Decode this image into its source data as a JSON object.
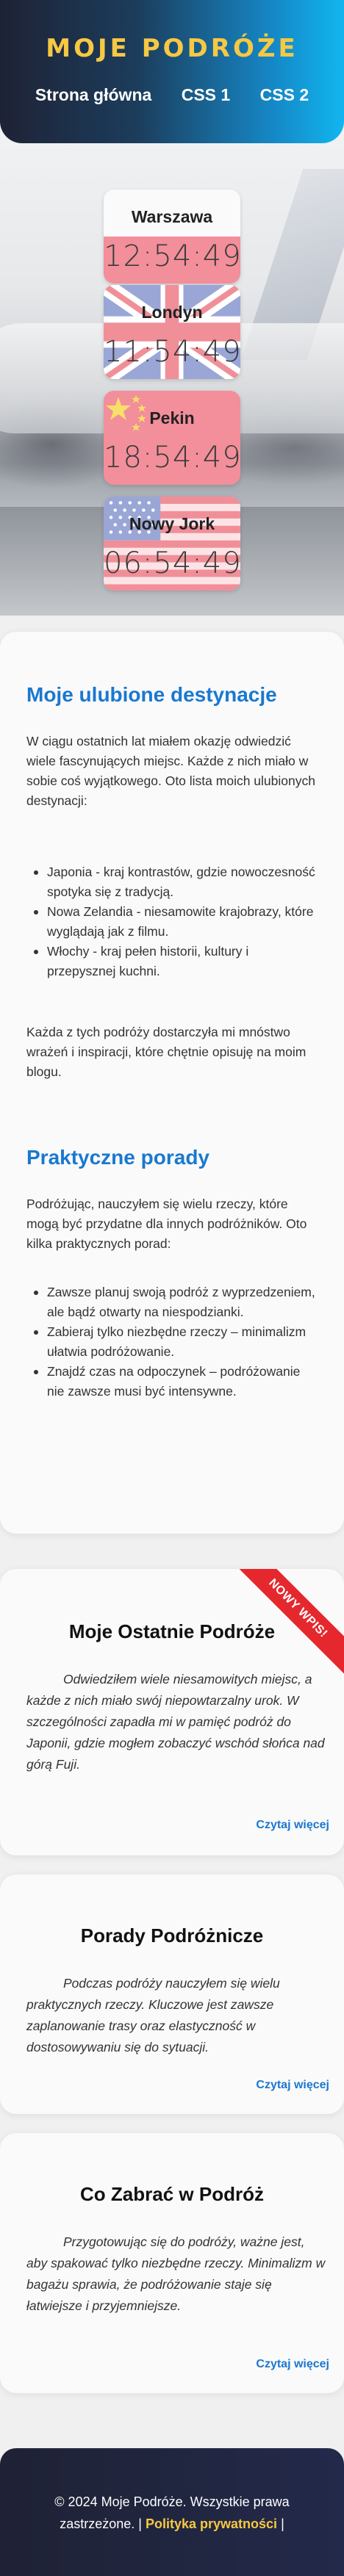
{
  "header": {
    "title": "MOJE PODRÓŻE",
    "nav": [
      "Strona główna",
      "CSS 1",
      "CSS 2"
    ]
  },
  "clocks": [
    {
      "city": "Warszawa",
      "time": "12:54:49",
      "flag": "pl"
    },
    {
      "city": "Londyn",
      "time": "11:54:49",
      "flag": "uk"
    },
    {
      "city": "Pekin",
      "time": "18:54:49",
      "flag": "cn"
    },
    {
      "city": "Nowy Jork",
      "time": "06:54:49",
      "flag": "us"
    }
  ],
  "intro": {
    "title1": "Moje ulubione destynacje",
    "para1": "W ciągu ostatnich lat miałem okazję odwiedzić wiele fascynujących miejsc. Każde z nich miało w sobie coś wyjątkowego. Oto lista moich ulubionych destynacji:",
    "list1": [
      "Japonia - kraj kontrastów, gdzie nowoczesność spotyka się z tradycją.",
      "Nowa Zelandia - niesamowite krajobrazy, które wyglądają jak z filmu.",
      "Włochy - kraj pełen historii, kultury i przepysznej kuchni."
    ],
    "para2": "Każda z tych podróży dostarczyła mi mnóstwo wrażeń i inspiracji, które chętnie opisuję na moim blogu.",
    "title2": "Praktyczne porady",
    "para3": "Podróżując, nauczyłem się wielu rzeczy, które mogą być przydatne dla innych podróżników. Oto kilka praktycznych porad:",
    "list2": [
      "Zawsze planuj swoją podróż z wyprzedzeniem, ale bądź otwarty na niespodzianki.",
      "Zabieraj tylko niezbędne rzeczy – minimalizm ułatwia podróżowanie.",
      "Znajdź czas na odpoczynek – podróżowanie nie zawsze musi być intensywne."
    ]
  },
  "posts": [
    {
      "title": "Moje Ostatnie Podróże",
      "body": "Odwiedziłem wiele niesamowitych miejsc, a każde z nich miało swój niepowtarzalny urok. W szczególności zapadła mi w pamięć podróż do Japonii, gdzie mogłem zobaczyć wschód słońca nad górą Fuji.",
      "more": "Czytaj więcej",
      "badge": "NOWY WPIS!"
    },
    {
      "title": "Porady Podróżnicze",
      "body": "Podczas podróży nauczyłem się wielu praktycznych rzeczy. Kluczowe jest zawsze zaplanowanie trasy oraz elastyczność w dostosowywaniu się do sytuacji.",
      "more": "Czytaj więcej"
    },
    {
      "title": "Co Zabrać w Podróż",
      "body": "Przygotowując się do podróży, ważne jest, aby spakować tylko niezbędne rzeczy. Minimalizm w bagażu sprawia, że podróżowanie staje się łatwiejsze i przyjemniejsze.",
      "more": "Czytaj więcej"
    }
  ],
  "footer": {
    "text": "© 2024 Moje Podróże. Wszystkie prawa zastrzeżone. |",
    "link": "Polityka prywatności",
    "tail": "|"
  },
  "colors": {
    "accent": "#1a78d0",
    "title_gold": "#f6c843",
    "badge_red": "#e4282e"
  }
}
